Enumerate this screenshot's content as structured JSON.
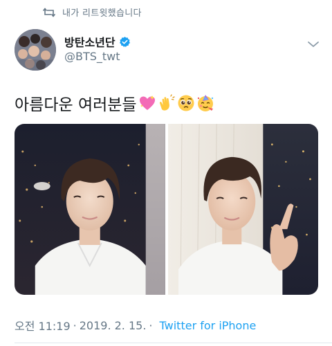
{
  "social_context": {
    "retweet_label": "내가 리트윗했습니다",
    "icon": "retweet-icon"
  },
  "author": {
    "display_name": "방탄소년단",
    "handle": "@BTS_twt",
    "verified": true
  },
  "tweet": {
    "text": "아름다운 여러분들",
    "emojis": [
      "sparkling-heart",
      "clapping-hands",
      "pleading-face",
      "partying-face"
    ],
    "media_count": 2
  },
  "metadata": {
    "time": "오전 11:19",
    "separator": "·",
    "date": "2019. 2. 15.",
    "source": "Twitter for iPhone"
  },
  "colors": {
    "text": "#14171a",
    "secondary": "#657786",
    "link": "#1da1f2",
    "divider": "#e1e8ed"
  }
}
